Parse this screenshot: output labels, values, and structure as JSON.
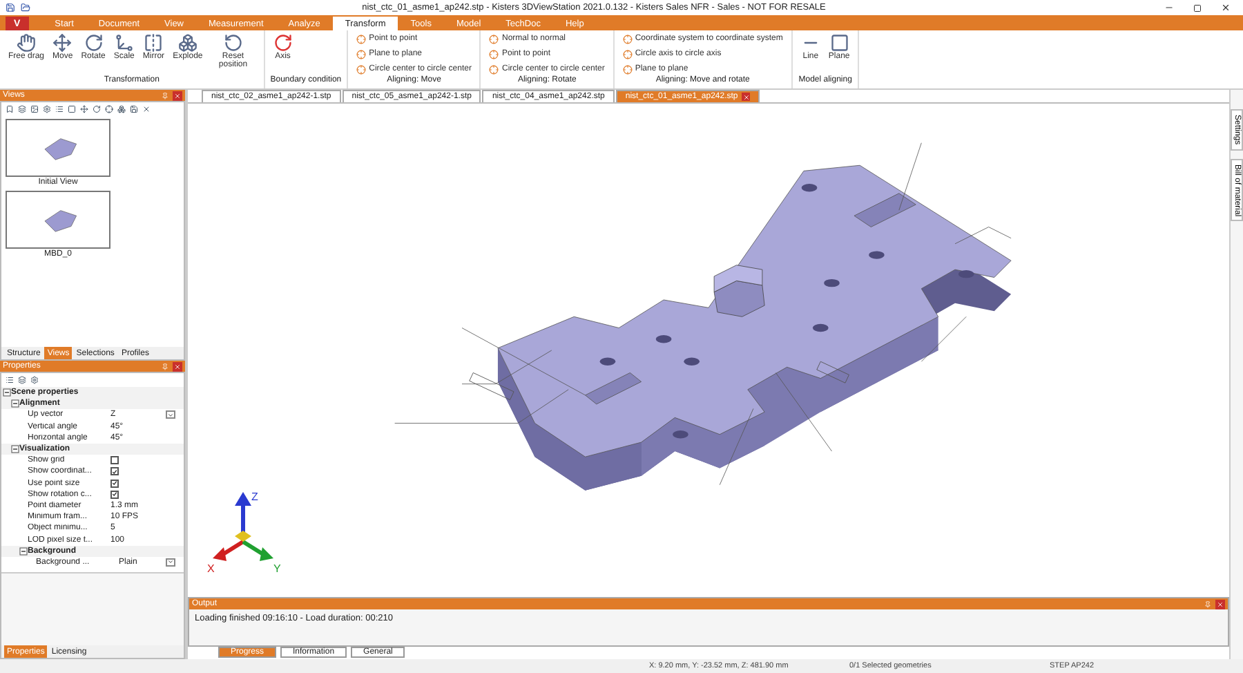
{
  "title_bar": {
    "title": "nist_ctc_01_asme1_ap242.stp - Kisters 3DViewStation 2021.0.132 - Kisters Sales NFR - Sales - NOT FOR RESALE"
  },
  "menu": {
    "app_button": "V",
    "tabs": [
      {
        "label": "Start",
        "selected": false
      },
      {
        "label": "Document",
        "selected": false
      },
      {
        "label": "View",
        "selected": false
      },
      {
        "label": "Measurement",
        "selected": false
      },
      {
        "label": "Analyze",
        "selected": false
      },
      {
        "label": "Transform",
        "selected": true
      },
      {
        "label": "Tools",
        "selected": false
      },
      {
        "label": "Model",
        "selected": false
      },
      {
        "label": "TechDoc",
        "selected": false
      },
      {
        "label": "Help",
        "selected": false
      }
    ]
  },
  "ribbon": [
    {
      "label": "Transformation",
      "kind": "large",
      "buttons": [
        {
          "label": "Free drag"
        },
        {
          "label": "Move"
        },
        {
          "label": "Rotate"
        },
        {
          "label": "Scale"
        },
        {
          "label": "Mirror"
        },
        {
          "label": "Explode"
        },
        {
          "label": "Reset position"
        }
      ]
    },
    {
      "label": "Boundary condition",
      "kind": "large",
      "buttons": [
        {
          "label": "Axis"
        }
      ]
    },
    {
      "label": "Aligning: Move",
      "kind": "small",
      "buttons": [
        {
          "label": "Point to point"
        },
        {
          "label": "Plane to plane"
        },
        {
          "label": "Circle center to circle center"
        }
      ]
    },
    {
      "label": "Aligning: Rotate",
      "kind": "small",
      "buttons": [
        {
          "label": "Normal to normal"
        },
        {
          "label": "Point to point"
        },
        {
          "label": "Circle center to circle center"
        }
      ]
    },
    {
      "label": "Aligning: Move and rotate",
      "kind": "small",
      "buttons": [
        {
          "label": "Coordinate system to coordinate system"
        },
        {
          "label": "Circle axis to circle axis"
        },
        {
          "label": "Plane to plane"
        }
      ]
    },
    {
      "label": "Model aligning",
      "kind": "large",
      "buttons": [
        {
          "label": "Line"
        },
        {
          "label": "Plane"
        }
      ]
    }
  ],
  "views_panel": {
    "title": "Views",
    "thumbnails": [
      {
        "label": "Initial View"
      },
      {
        "label": "MBD_0"
      }
    ],
    "tabs": [
      {
        "label": "Structure",
        "selected": false
      },
      {
        "label": "Views",
        "selected": true
      },
      {
        "label": "Selections",
        "selected": false
      },
      {
        "label": "Profiles",
        "selected": false
      }
    ]
  },
  "properties_panel": {
    "title": "Properties",
    "tree": [
      {
        "label": "Scene properties",
        "kind": "category",
        "children": [
          {
            "label": "Alignment",
            "kind": "category",
            "children": [
              {
                "label": "Up vector",
                "kind": "dropdown",
                "value": "Z"
              },
              {
                "label": "Vertical angle",
                "kind": "text",
                "value": "45°"
              },
              {
                "label": "Horizontal angle",
                "kind": "text",
                "value": "45°"
              }
            ]
          },
          {
            "label": "Visualization",
            "kind": "category",
            "children": [
              {
                "label": "Show grid",
                "kind": "checkbox",
                "checked": false
              },
              {
                "label": "Show coordinat...",
                "kind": "checkbox",
                "checked": true
              },
              {
                "label": "Use point size",
                "kind": "checkbox",
                "checked": true
              },
              {
                "label": "Show rotation c...",
                "kind": "checkbox",
                "checked": true
              },
              {
                "label": "Point diameter",
                "kind": "text",
                "value": "1.3 mm"
              },
              {
                "label": "Minimum fram...",
                "kind": "text",
                "value": "10 FPS"
              },
              {
                "label": "Object minimu...",
                "kind": "text",
                "value": "5"
              },
              {
                "label": "LOD pixel size t...",
                "kind": "text",
                "value": "100"
              },
              {
                "label": "Background",
                "kind": "category",
                "children": [
                  {
                    "label": "Background ...",
                    "kind": "dropdown",
                    "value": "Plain"
                  }
                ]
              }
            ]
          }
        ]
      }
    ],
    "tabs": [
      {
        "label": "Properties",
        "selected": true
      },
      {
        "label": "Licensing",
        "selected": false
      }
    ]
  },
  "document_tabs": [
    {
      "label": "nist_ctc_02_asme1_ap242-1.stp",
      "selected": false
    },
    {
      "label": "nist_ctc_05_asme1_ap242-1.stp",
      "selected": false
    },
    {
      "label": "nist_ctc_04_asme1_ap242.stp",
      "selected": false
    },
    {
      "label": "nist_ctc_01_asme1_ap242.stp",
      "selected": true
    }
  ],
  "triad": {
    "x": "X",
    "y": "Y",
    "z": "Z"
  },
  "side_tabs": [
    {
      "label": "Settings"
    },
    {
      "label": "Bill of material"
    }
  ],
  "output": {
    "title": "Output",
    "lines": [
      "Loading finished 09:16:10 - Load duration: 00:210"
    ],
    "tabs": [
      {
        "label": "Progress",
        "selected": true
      },
      {
        "label": "Information",
        "selected": false
      },
      {
        "label": "General",
        "selected": false
      }
    ]
  },
  "status_bar": {
    "coordinates": "X: 9.20 mm, Y: -23.52 mm, Z: 481.90 mm",
    "selection": "0/1 Selected geometries",
    "format": "STEP AP242"
  }
}
